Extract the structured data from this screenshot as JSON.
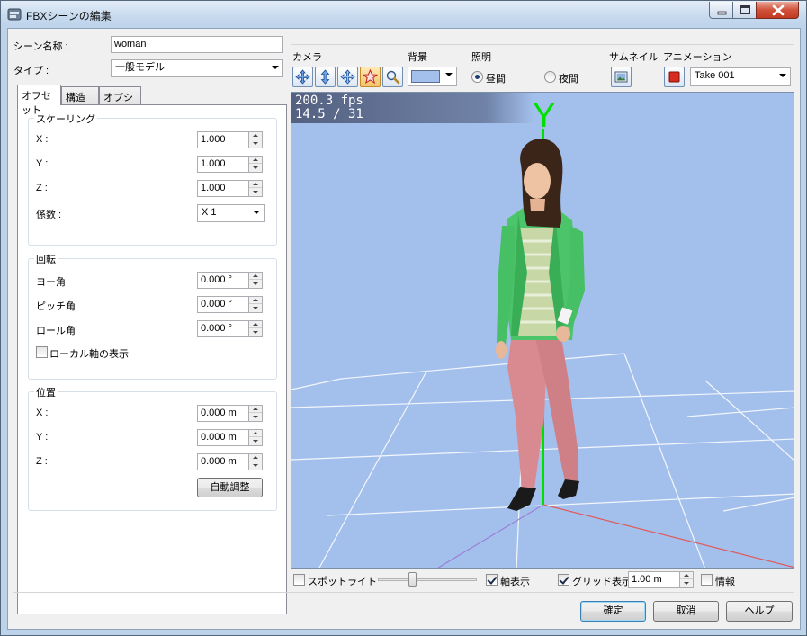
{
  "window": {
    "title": "FBXシーンの編集"
  },
  "scene": {
    "name_label": "シーン名称 :",
    "name_value": "woman",
    "type_label": "タイプ :",
    "type_value": "一般モデル"
  },
  "tabs": [
    {
      "label": "オフセット",
      "active": true
    },
    {
      "label": "構造",
      "active": false
    },
    {
      "label": "オプション",
      "active": false
    }
  ],
  "scaling": {
    "title": "スケーリング",
    "x_label": "X :",
    "x_value": "1.000",
    "y_label": "Y :",
    "y_value": "1.000",
    "z_label": "Z :",
    "z_value": "1.000",
    "factor_label": "係数 :",
    "factor_value": "X 1"
  },
  "rotation": {
    "title": "回転",
    "yaw_label": "ヨー角",
    "yaw_value": "0.000 °",
    "pitch_label": "ピッチ角",
    "pitch_value": "0.000 °",
    "roll_label": "ロール角",
    "roll_value": "0.000 °",
    "local_axis_label": "ローカル軸の表示",
    "local_axis_checked": false
  },
  "position": {
    "title": "位置",
    "x_label": "X :",
    "x_value": "0.000 m",
    "y_label": "Y :",
    "y_value": "0.000 m",
    "z_label": "Z :",
    "z_value": "0.000 m",
    "auto_button": "自動調整"
  },
  "toolbar": {
    "camera_label": "カメラ",
    "background_label": "背景",
    "background_color": "#a3c0ec",
    "lighting_label": "照明",
    "day_label": "昼間",
    "night_label": "夜間",
    "thumbnail_label": "サムネイル",
    "animation_label": "アニメーション",
    "take_value": "Take 001"
  },
  "viewport": {
    "fps": "200.3 fps",
    "frame": "14.5 / 31",
    "axis_label": "Y"
  },
  "bottom": {
    "spotlight_label": "スポットライト",
    "spotlight_checked": false,
    "axis_label": "軸表示",
    "axis_checked": true,
    "grid_label": "グリッド表示",
    "grid_checked": true,
    "grid_value": "1.00 m",
    "info_label": "情報",
    "info_checked": false
  },
  "footer": {
    "ok": "確定",
    "cancel": "取消",
    "help": "ヘルプ"
  }
}
